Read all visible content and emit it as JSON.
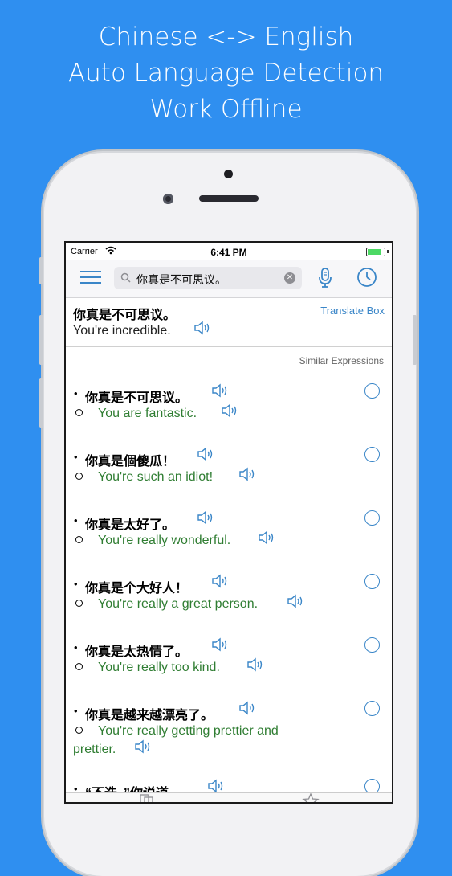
{
  "headline": [
    "Chinese <-> English",
    "Auto Language Detection",
    "Work Offline"
  ],
  "status": {
    "carrier": "Carrier",
    "time": "6:41 PM",
    "battery_level": 0.9
  },
  "toolbar": {
    "search_value": "你真是不可思议。",
    "menu_icon": "menu-icon",
    "mic_icon": "microphone-icon",
    "history_icon": "clock-icon"
  },
  "result": {
    "chinese": "你真是不可思议。",
    "english": "You're incredible.",
    "translate_box": "Translate Box"
  },
  "similar_label": "Similar Expressions",
  "expressions": [
    {
      "chinese": "你真是不可思议。",
      "english": "You are fantastic."
    },
    {
      "chinese": "你真是個傻瓜！",
      "english": "You're such an idiot!"
    },
    {
      "chinese": "你真是太好了。",
      "english": "You're really wonderful."
    },
    {
      "chinese": "你真是个大好人！",
      "english": "You're really a great person."
    },
    {
      "chinese": "你真是太热情了。",
      "english": "You're really too kind."
    },
    {
      "chinese": "你真是越来越漂亮了。",
      "english_line1": "You're really getting prettier and",
      "english_line2": "prettier."
    },
    {
      "chinese": "“不迭，”你说道"
    }
  ],
  "colors": {
    "background": "#2f8ff0",
    "accent": "#3a86c8",
    "english_text": "#2f7d32"
  }
}
